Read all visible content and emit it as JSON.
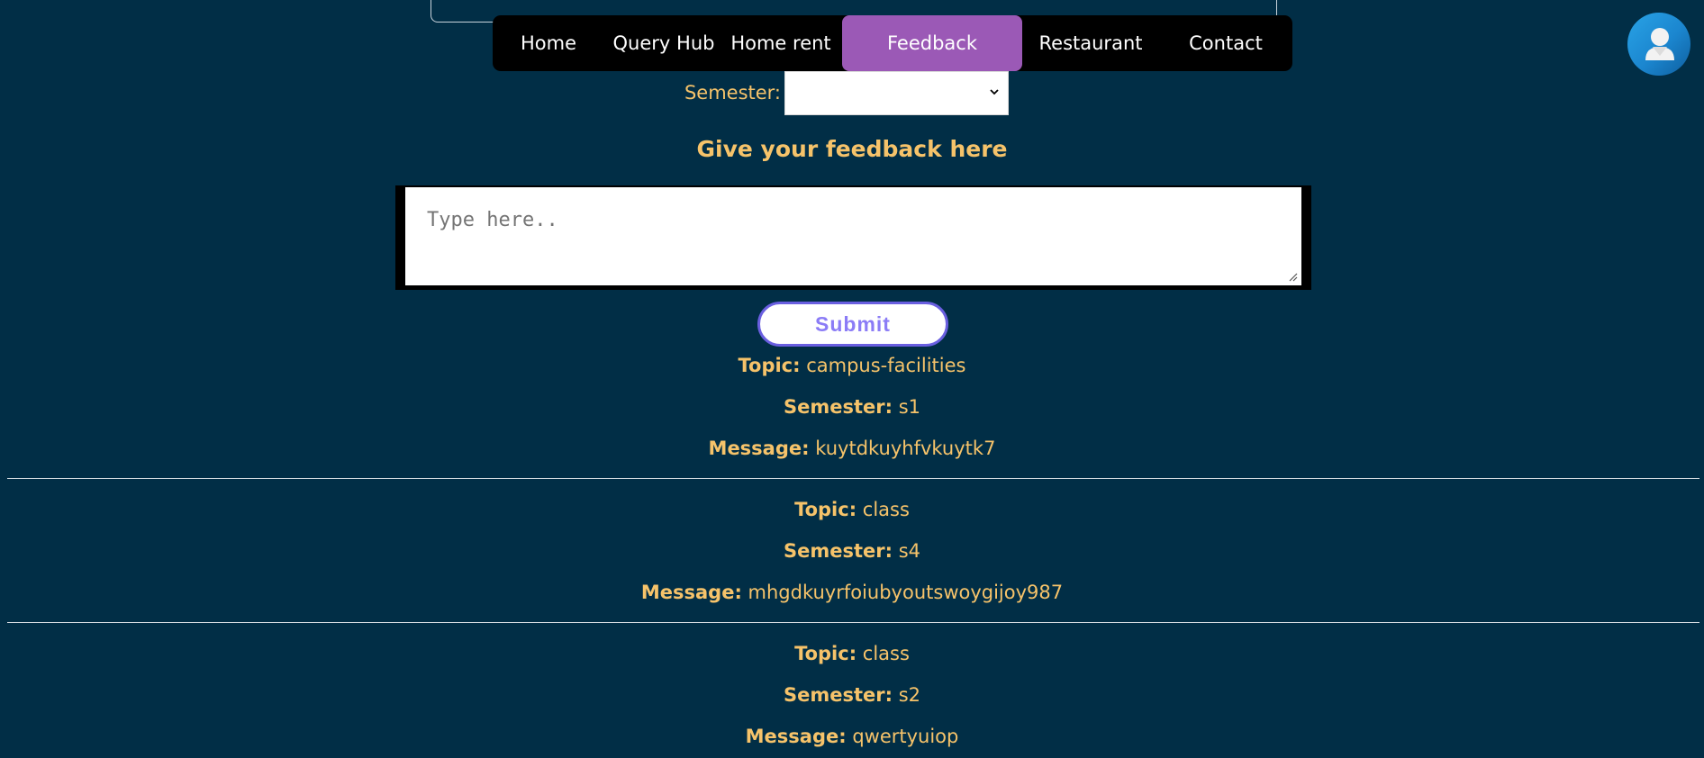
{
  "nav": {
    "items": [
      {
        "label": "Home"
      },
      {
        "label": "Query Hub"
      },
      {
        "label": "Home rent"
      },
      {
        "label": "Feedback"
      },
      {
        "label": "Restaurant"
      },
      {
        "label": "Contact"
      }
    ],
    "active": "Feedback"
  },
  "form": {
    "semester_label": "Semester:",
    "semester_value": "",
    "heading": "Give your feedback here",
    "textarea_placeholder": "Type here..",
    "submit_label": "Submit"
  },
  "feedback": {
    "topic_label": "Topic:",
    "semester_label": "Semester:",
    "message_label": "Message:",
    "entries": [
      {
        "topic": "campus-facilities",
        "semester": "s1",
        "message": "kuytdkuyhfvkuytk7"
      },
      {
        "topic": "class",
        "semester": "s4",
        "message": "mhgdkuyrfoiubyoutswoygijoy987"
      },
      {
        "topic": "class",
        "semester": "s2",
        "message": "qwertyuiop"
      }
    ]
  },
  "colors": {
    "background": "#012e46",
    "accent_text": "#f6c36a",
    "nav_active": "#9b59b6",
    "submit_border": "#6a5fe0"
  },
  "icons": {
    "avatar": "user-avatar-icon",
    "select_arrow": "chevron-down-icon",
    "resize_handle": "resize-grip-icon"
  }
}
